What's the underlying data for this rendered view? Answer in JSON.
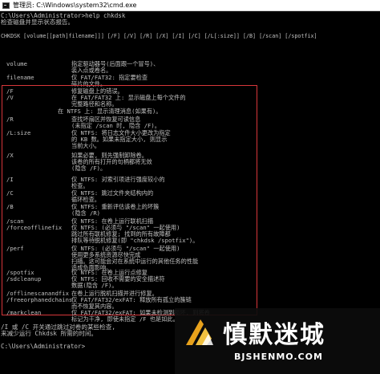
{
  "window": {
    "title": "管理员: C:\\Windows\\system32\\cmd.exe"
  },
  "console": {
    "prompt1": "C:\\Users\\Administrator>help chkdsk",
    "line2": "检查磁盘并显示状态报告。",
    "usage": "CHKDSK [volume[[path]filename]]] [/F] [/V] [/R] [/X] [/I] [/C] [/L[:size]] [/B] [/scan] [/spotfix]",
    "options": [
      {
        "name": "volume",
        "desc": "指定驱动器号(后面跟一个冒号)、\n装入点或卷名。"
      },
      {
        "name": "filename",
        "desc": "仅 FAT/FAT32: 指定要检查\n碎片的文件。"
      },
      {
        "name": "/F",
        "desc": "修复磁盘上的错误。"
      },
      {
        "name": "/V",
        "desc": "在 FAT/FAT32 上: 显示磁盘上每个文件的\n完整路径和名称。"
      },
      {
        "name": "",
        "desc": "在 NTFS 上: 显示清理消息(如果有)。"
      },
      {
        "name": "/R",
        "desc": "查找坏扇区并恢复可读信息\n(未指定 /scan 时, 隐含 /F)。"
      },
      {
        "name": "/L:size",
        "desc": "仅 NTFS: 将日志文件大小更改为指定\n的 KB 数。如果未指定大小, 则显示\n当前大小。"
      },
      {
        "name": "/X",
        "desc": "如果必要, 则先强制卸除卷。\n该卷的所有打开的句柄都将无效\n(隐含 /F)。"
      },
      {
        "name": "/I",
        "desc": "仅 NTFS: 对索引项进行强度较小的\n检查。"
      },
      {
        "name": "/C",
        "desc": "仅 NTFS: 跳过文件夹结构内的\n循环检查。"
      },
      {
        "name": "/B",
        "desc": "仅 NTFS: 重新评估该卷上的坏簇\n(隐含 /R)"
      },
      {
        "name": "/scan",
        "desc": "仅 NTFS: 在卷上运行联机扫描"
      },
      {
        "name": "/forceofflinefix",
        "desc": "仅 NTFS: (必须与 \"/scan\" 一起使用)\n跳过所有联机修复; 找到的所有故障都\n排队等待脱机修复(即 \"chkdsk /spotfix\")。"
      },
      {
        "name": "/perf",
        "desc": "仅 NTFS: (必须与 \"/scan\" 一起使用)\n使用更多系统资源尽快完成\n扫描。这可能会对在系统中运行的其他任务的性能\n造成负面影响。"
      },
      {
        "name": "/spotfix",
        "desc": "仅 NTFS: 在卷上运行点修复"
      },
      {
        "name": "/sdcleanup",
        "desc": "仅 NTFS: 回收不需要的安全描述符\n数据(隐含 /F)。"
      },
      {
        "name": "/offlinescanandfix",
        "desc": "在卷上运行脱机扫描并进行修复。"
      },
      {
        "name": "/freeorphanedchains",
        "desc": "仅 FAT/FAT32/exFAT: 释放所有孤立的簇链\n而不恢复其内容。"
      },
      {
        "name": "/markclean",
        "desc": "仅 FAT/FAT32/exFAT: 如果未检测到损坏, 则将卷\n标记为干净, 即使未指定 /F 也是如此。"
      }
    ],
    "footer1": "/I 或 /C 开关通过跳过对卷的某些检查,",
    "footer2": "来减少运行 Chkdsk 所需的时间。",
    "prompt2": "C:\\Users\\Administrator>"
  },
  "watermark": {
    "title": "慎默迷城",
    "url": "BJSHENMO.COM"
  },
  "colors": {
    "console_bg": "#000000",
    "console_text": "#c0c0c0",
    "highlight_box": "#d8363a"
  }
}
